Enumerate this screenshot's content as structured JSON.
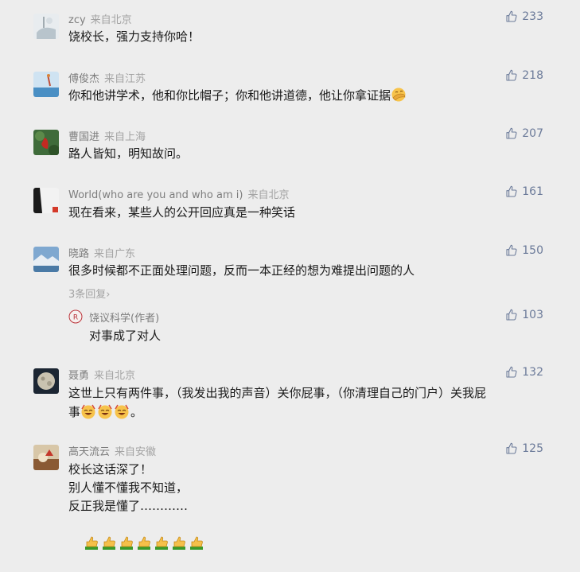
{
  "comments": [
    {
      "user": "zcy",
      "location": "来自北京",
      "text": "饶校长，强力支持你哈！",
      "likes": "233"
    },
    {
      "user": "傅俊杰",
      "location": "来自江苏",
      "text": "你和他讲学术，他和你比帽子；你和他讲道德，他让你拿证据",
      "likes": "218"
    },
    {
      "user": "曹国进",
      "location": "来自上海",
      "text": "路人皆知，明知故问。",
      "likes": "207"
    },
    {
      "user": "World(who are you and who am i)",
      "location": "来自北京",
      "text": "现在看来，某些人的公开回应真是一种笑话",
      "likes": "161"
    },
    {
      "user": "晓路",
      "location": "来自广东",
      "text": "很多时候都不正面处理问题，反而一本正经的想为难提出问题的人",
      "likes": "150",
      "replies_link": "3条回复",
      "reply": {
        "user": "饶议科学(作者)",
        "text": "对事成了对人",
        "likes": "103"
      }
    },
    {
      "user": "聂勇",
      "location": "来自北京",
      "text_line1": "这世上只有两件事，（我发出我的声音）关你屁事，（你清理自己的门户）关我屁",
      "text_line2": "事",
      "text_line2_end": "。",
      "likes": "132"
    },
    {
      "user": "高天流云",
      "location": "来自安徽",
      "lines": [
        "校长这话深了！",
        "别人懂不懂我不知道，",
        "反正我是懂了…………"
      ],
      "likes": "125"
    }
  ],
  "icons": {
    "like": "thumbs-up-outline-icon",
    "emoji_facepalm": "facepalm-emoji",
    "emoji_laugh": "laughing-emoji",
    "emoji_thumb": "thumbs-up-emoji"
  },
  "colors": {
    "background": "#ededed",
    "like": "#6b7a99",
    "muted": "#a3a3a3"
  }
}
